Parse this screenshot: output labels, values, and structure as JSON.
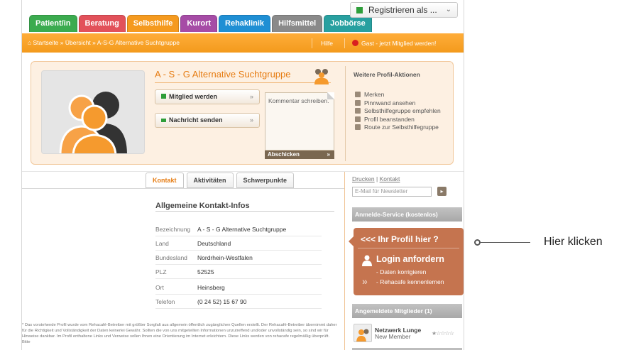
{
  "top_tabs": [
    {
      "label": "Patient/in",
      "color": "#3bab4f"
    },
    {
      "label": "Beratung",
      "color": "#e2515a"
    },
    {
      "label": "Selbsthilfe",
      "color": "#f59a1f"
    },
    {
      "label": "Kurort",
      "color": "#a64ca6"
    },
    {
      "label": "Rehaklinik",
      "color": "#1f8fd4"
    },
    {
      "label": "Hilfsmittel",
      "color": "#8a8a8a"
    },
    {
      "label": "Jobbörse",
      "color": "#28a0a0"
    }
  ],
  "register": {
    "label": "Registrieren als ..."
  },
  "breadcrumb": {
    "text": "Startseite » Übersicht » A-S-G Alternative Suchtgruppe"
  },
  "topbar": {
    "help": "Hilfe",
    "guest": "Gast - jetzt Mitglied werden!"
  },
  "profile": {
    "name": "A - S - G Alternative Suchtgruppe",
    "member_button": "Mitglied werden",
    "message_button": "Nachricht senden",
    "comment_placeholder": "Kommentar schreiben.",
    "submit": "Abschicken",
    "arrow": "»"
  },
  "actions": {
    "title": "Weitere Profil-Aktionen",
    "items": [
      "Merken",
      "Pinnwand ansehen",
      "Selbsthilfegruppe empfehlen",
      "Profil beanstanden",
      "Route zur Selbsthilfegruppe"
    ]
  },
  "tabs": [
    "Kontakt",
    "Aktivitäten",
    "Schwerpunkte"
  ],
  "contact": {
    "title": "Allgemeine Kontakt-Infos",
    "rows": [
      {
        "k": "Bezeichnung",
        "v": "A - S - G Alternative Suchtgruppe"
      },
      {
        "k": "Land",
        "v": "Deutschland"
      },
      {
        "k": "Bundesland",
        "v": "Nordrhein-Westfalen"
      },
      {
        "k": "PLZ",
        "v": "52525"
      },
      {
        "k": "Ort",
        "v": "Heinsberg"
      },
      {
        "k": "Telefon",
        "v": "(0 24 52) 15 67 90"
      }
    ]
  },
  "disclaimer": "* Das vorstehende Profil wurde vom Rehacafé-Betreiber mit größter Sorgfalt aus allgemein öffentlich zugänglichen Quellen erstellt. Der Rehacafé-Betreiber übernimmt daher für die Richtigkeit und Vollständigkeit der Daten keinerlei Gewähr. Sollten die von uns mitgeteilten Informationen unzutreffend und/oder unvollständig sein, so sind wir für Hinweise dankbar. Im Profil enthaltene Links und Verweise sollen Ihnen eine Orientierung im Internet erleichtern. Diese Links werden von rehacafe regelmäßig überprüft. Bitte",
  "sidebar": {
    "print": "Drucken",
    "contact": "Kontakt",
    "newsletter_placeholder": "E-Mail für Newsletter",
    "anmelde_title": "Anmelde-Service (kostenlos)",
    "promo_title": "<<< Ihr Profil hier ?",
    "promo_login": "Login anfordern",
    "promo_l1": "- Daten korrigieren",
    "promo_l2": "- Rehacafe kennenlernen",
    "members_title": "Angemeldete Mitglieder (1)",
    "member_name": "Netzwerk Lunge",
    "member_role": "New Member",
    "member_stars": "★☆☆☆☆"
  },
  "callout": {
    "text": "Hier klicken"
  }
}
